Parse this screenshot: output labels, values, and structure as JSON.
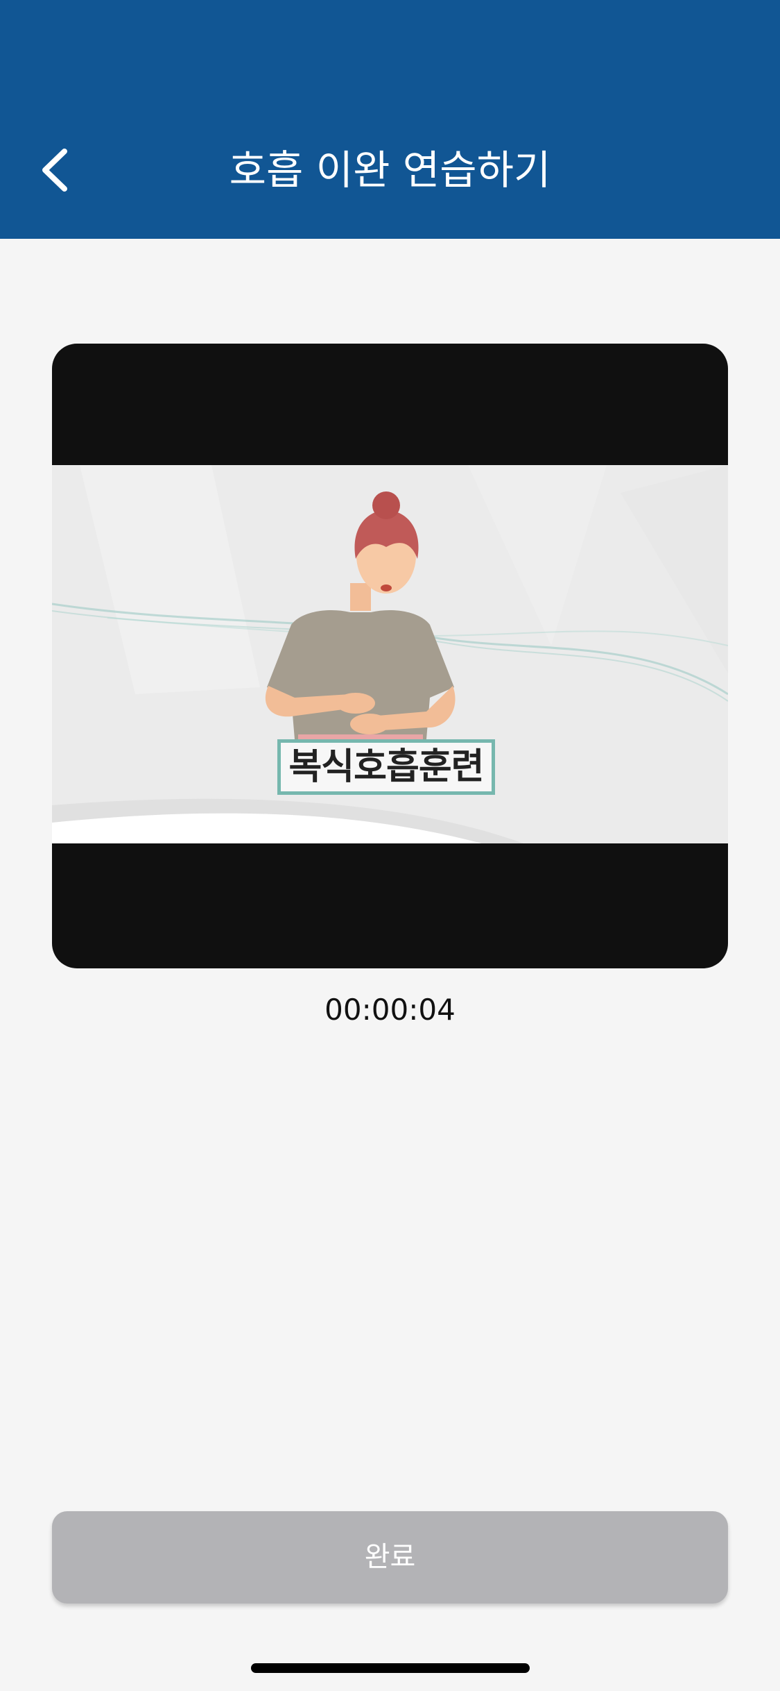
{
  "header": {
    "title": "호흡 이완 연습하기",
    "back_icon": "chevron-left-icon",
    "background_color": "#115694"
  },
  "video": {
    "caption": "복식호흡훈련",
    "elapsed": "00:00:04"
  },
  "footer": {
    "done_label": "완료",
    "done_button_color": "#b3b3b6"
  }
}
